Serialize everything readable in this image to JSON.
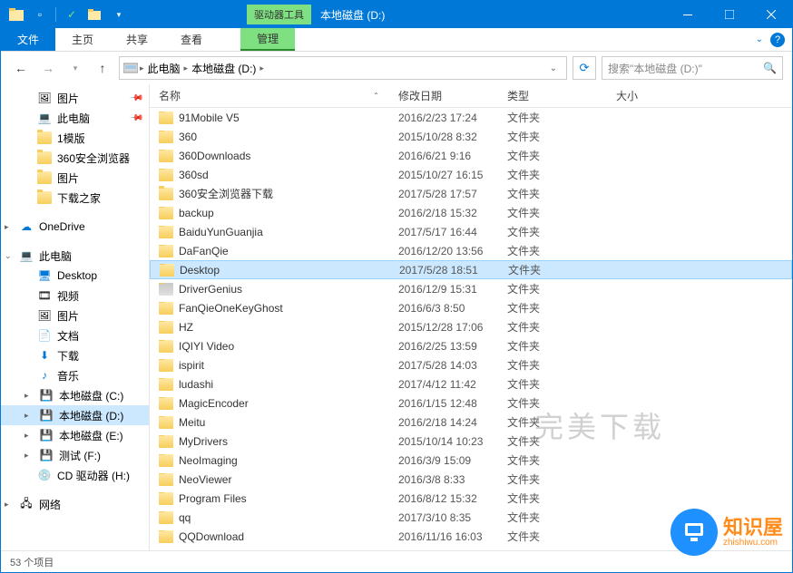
{
  "window": {
    "drive_tools_label": "驱动器工具",
    "title": "本地磁盘 (D:)"
  },
  "ribbon": {
    "file": "文件",
    "home": "主页",
    "share": "共享",
    "view": "查看",
    "manage": "管理"
  },
  "address": {
    "crumb1": "此电脑",
    "crumb2": "本地磁盘 (D:)",
    "search_placeholder": "搜索\"本地磁盘 (D:)\""
  },
  "tree": {
    "pictures": "图片",
    "this_pc_q": "此电脑",
    "template1": "1模版",
    "browser360": "360安全浏览器",
    "pictures2": "图片",
    "download_home": "下载之家",
    "onedrive": "OneDrive",
    "this_pc": "此电脑",
    "desktop": "Desktop",
    "videos": "视频",
    "pictures3": "图片",
    "documents": "文档",
    "downloads": "下载",
    "music": "音乐",
    "disk_c": "本地磁盘 (C:)",
    "disk_d": "本地磁盘 (D:)",
    "disk_e": "本地磁盘 (E:)",
    "test_f": "测试 (F:)",
    "cd_h": "CD 驱动器 (H:)",
    "network": "网络"
  },
  "columns": {
    "name": "名称",
    "date": "修改日期",
    "type": "类型",
    "size": "大小"
  },
  "folder_type": "文件夹",
  "files": [
    {
      "name": "91Mobile V5",
      "date": "2016/2/23 17:24"
    },
    {
      "name": "360",
      "date": "2015/10/28 8:32"
    },
    {
      "name": "360Downloads",
      "date": "2016/6/21 9:16"
    },
    {
      "name": "360sd",
      "date": "2015/10/27 16:15"
    },
    {
      "name": "360安全浏览器下载",
      "date": "2017/5/28 17:57"
    },
    {
      "name": "backup",
      "date": "2016/2/18 15:32"
    },
    {
      "name": "BaiduYunGuanjia",
      "date": "2017/5/17 16:44"
    },
    {
      "name": "DaFanQie",
      "date": "2016/12/20 13:56"
    },
    {
      "name": "Desktop",
      "date": "2017/5/28 18:51",
      "selected": true
    },
    {
      "name": "DriverGenius",
      "date": "2016/12/9 15:31",
      "special": true
    },
    {
      "name": "FanQieOneKeyGhost",
      "date": "2016/6/3 8:50"
    },
    {
      "name": "HZ",
      "date": "2015/12/28 17:06"
    },
    {
      "name": "IQIYI Video",
      "date": "2016/2/25 13:59"
    },
    {
      "name": "ispirit",
      "date": "2017/5/28 14:03"
    },
    {
      "name": "ludashi",
      "date": "2017/4/12 11:42"
    },
    {
      "name": "MagicEncoder",
      "date": "2016/1/15 12:48"
    },
    {
      "name": "Meitu",
      "date": "2016/2/18 14:24"
    },
    {
      "name": "MyDrivers",
      "date": "2015/10/14 10:23"
    },
    {
      "name": "NeoImaging",
      "date": "2016/3/9 15:09"
    },
    {
      "name": "NeoViewer",
      "date": "2016/3/8 8:33"
    },
    {
      "name": "Program Files",
      "date": "2016/8/12 15:32"
    },
    {
      "name": "qq",
      "date": "2017/3/10 8:35"
    },
    {
      "name": "QQDownload",
      "date": "2016/11/16 16:03"
    }
  ],
  "status": {
    "count": "53 个项目"
  },
  "watermark": {
    "text": "完美下载",
    "logo": "知识屋",
    "logo_sub": "zhishiwu.com"
  }
}
